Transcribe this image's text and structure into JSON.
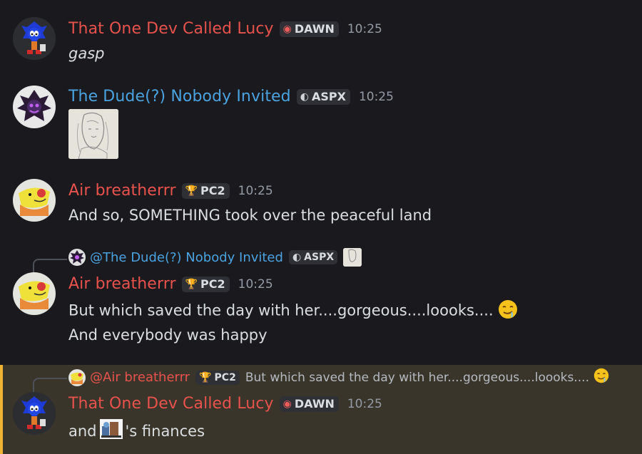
{
  "colors": {
    "lucy": "#e8524d",
    "dude": "#4aa3e0",
    "air": "#e8524d",
    "background": "#1a1a1e",
    "highlight_bg": "#3a352a",
    "highlight_bar": "#f0b232"
  },
  "messages": [
    {
      "author": "That One Dev Called Lucy",
      "tag": "DAWN",
      "tag_icon": "dawn-icon",
      "time": "10:25",
      "text": "gasp"
    },
    {
      "author": "The Dude(?) Nobody Invited",
      "tag": "ASPX",
      "tag_icon": "aspx-icon",
      "time": "10:25",
      "attachment": "sketch-image"
    },
    {
      "author": "Air breatherrr",
      "tag": "PC2",
      "tag_icon": "trophy-icon",
      "time": "10:25",
      "text": "And so, SOMETHING took over the peaceful land"
    },
    {
      "reply_to": "@The Dude(?) Nobody Invited",
      "reply_tag": "ASPX",
      "author": "Air breatherrr",
      "tag": "PC2",
      "tag_icon": "trophy-icon",
      "time": "10:25",
      "text": "But which saved the day with her....gorgeous....loooks....",
      "text2": "And everybody was happy"
    },
    {
      "reply_to": "@Air breatherrr",
      "reply_tag": "PC2",
      "reply_text": "But which saved the day with her....gorgeous....loooks....",
      "author": "That One Dev Called Lucy",
      "tag": "DAWN",
      "tag_icon": "dawn-icon",
      "time": "10:25",
      "text_pre": "and",
      "text_post": "'s finances"
    }
  ]
}
